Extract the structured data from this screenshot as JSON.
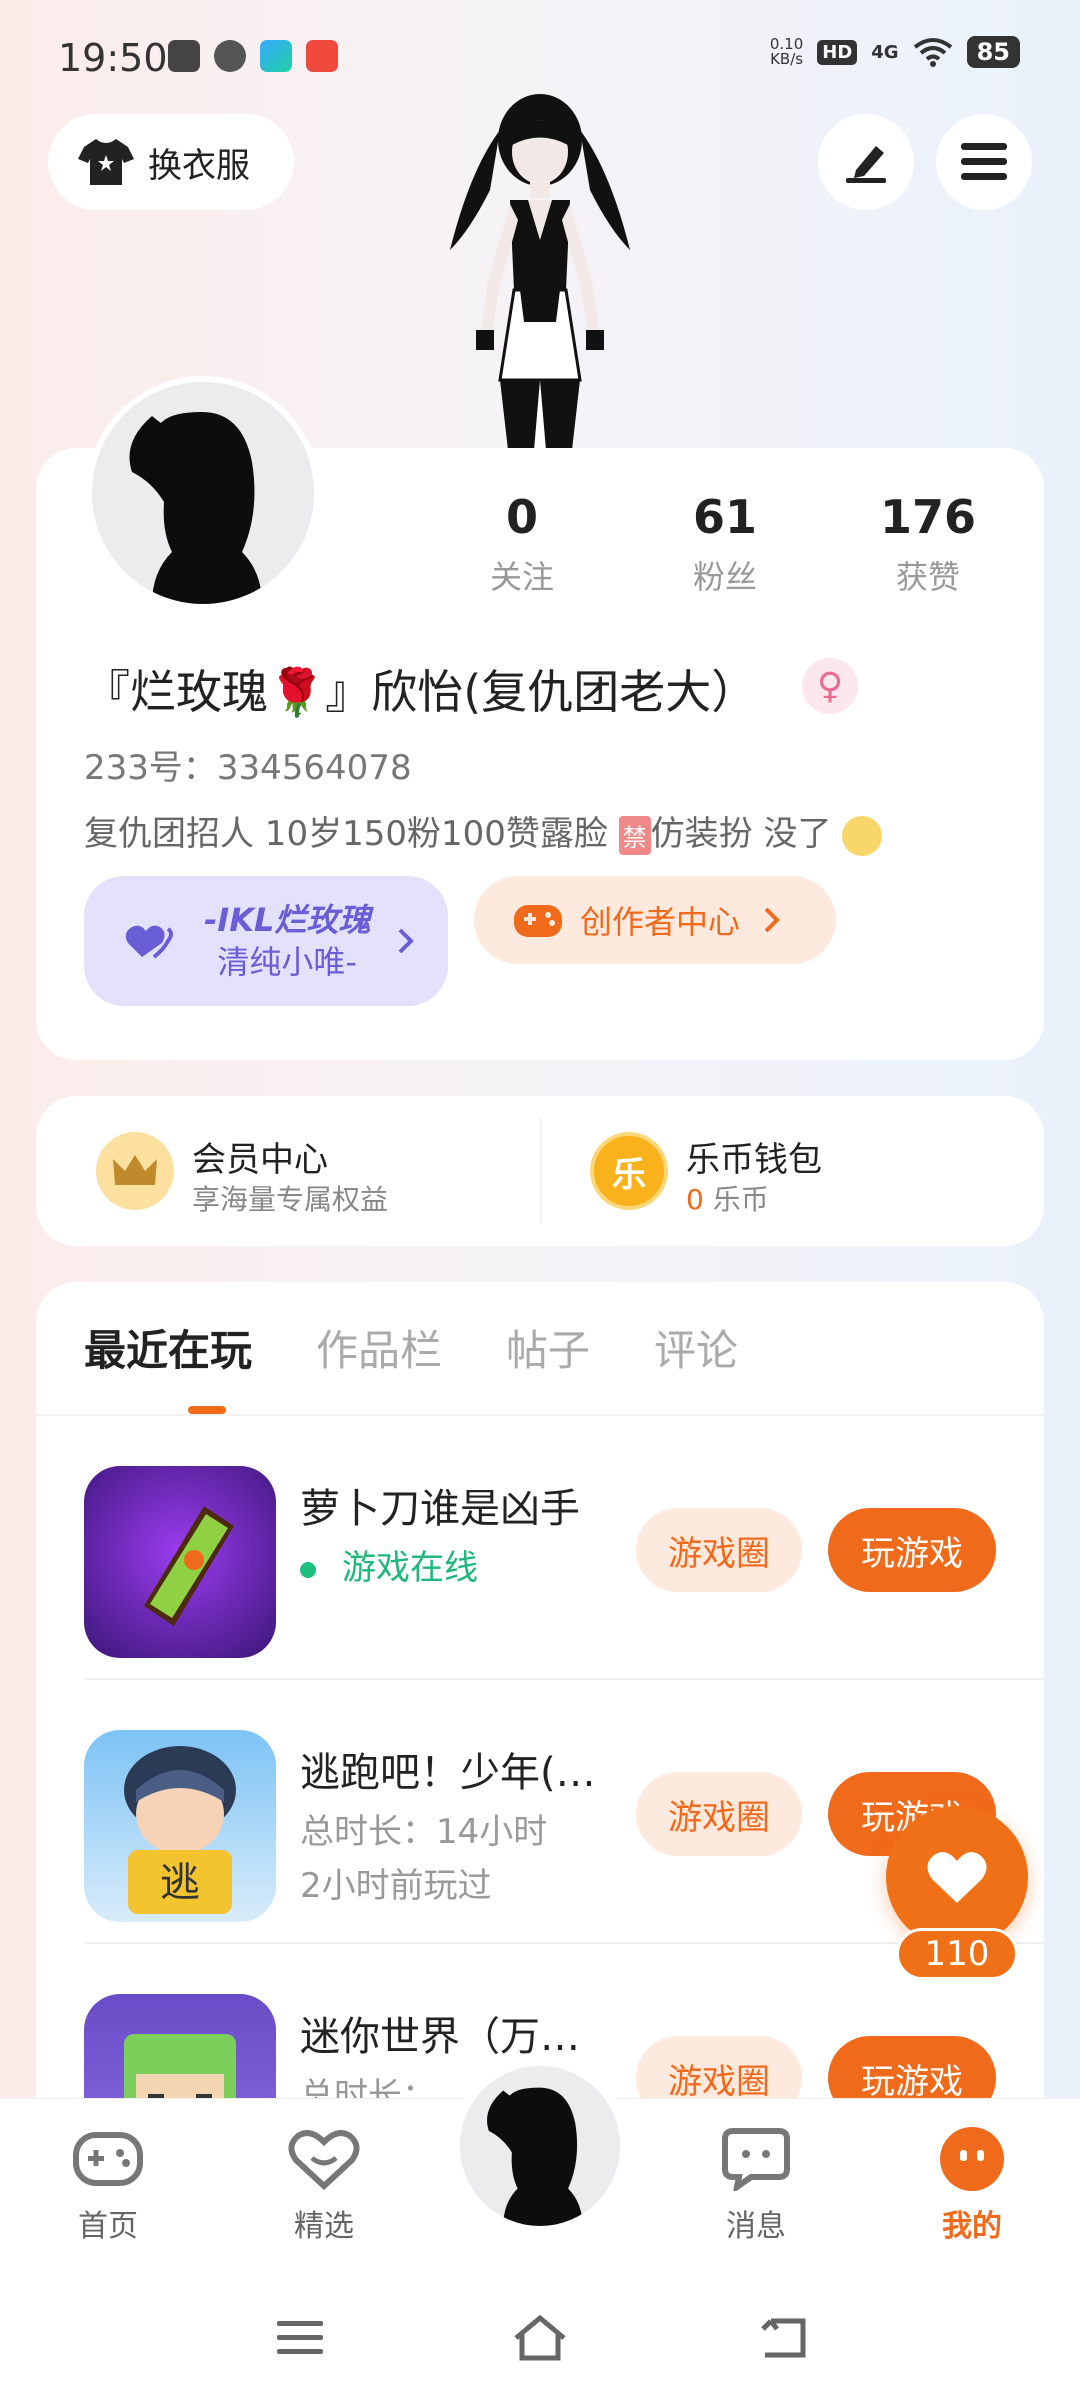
{
  "status_bar": {
    "time": "19:50",
    "net_speed_value": "0.10",
    "net_speed_unit": "KB/s",
    "hd_label": "HD",
    "signal_label": "4G",
    "battery": "85"
  },
  "header": {
    "outfit_label": "换衣服"
  },
  "profile": {
    "stats": [
      {
        "value": "0",
        "label": "关注"
      },
      {
        "value": "61",
        "label": "粉丝"
      },
      {
        "value": "176",
        "label": "获赞"
      }
    ],
    "nickname": "『烂玫瑰🌹』欣怡(复仇团老大）",
    "gender_symbol": "♀",
    "user_id": "233号：334564078",
    "bio_before": "复仇团招人 10岁150粉100赞露脸 ",
    "bio_ban": "禁",
    "bio_after": "仿装扮 没了",
    "group_tag_line1": "-IKL烂玫瑰",
    "group_tag_line2": "清纯小唯-",
    "creator_center_label": "创作者中心"
  },
  "membership": {
    "vip_title": "会员中心",
    "vip_sub": "享海量专属权益",
    "wallet_title": "乐币钱包",
    "wallet_icon_char": "乐",
    "wallet_count": "0",
    "wallet_unit": " 乐币"
  },
  "tabs": [
    "最近在玩",
    "作品栏",
    "帖子",
    "评论"
  ],
  "games": [
    {
      "name": "萝卜刀谁是凶手",
      "status": "游戏在线",
      "circle_label": "游戏圈",
      "play_label": "玩游戏"
    },
    {
      "name": "逃跑吧！少年(…",
      "duration": "总时长：14小时",
      "last_played": "2小时前玩过",
      "circle_label": "游戏圈",
      "play_label": "玩游戏"
    },
    {
      "name": "迷你世界（万…",
      "duration": "总时长：",
      "circle_label": "游戏圈",
      "play_label": "玩游戏"
    }
  ],
  "like_fab": {
    "count": "110"
  },
  "bottom_nav": {
    "items": [
      {
        "label": "首页"
      },
      {
        "label": "精选"
      },
      {
        "label": "消息"
      },
      {
        "label": "我的"
      }
    ]
  }
}
